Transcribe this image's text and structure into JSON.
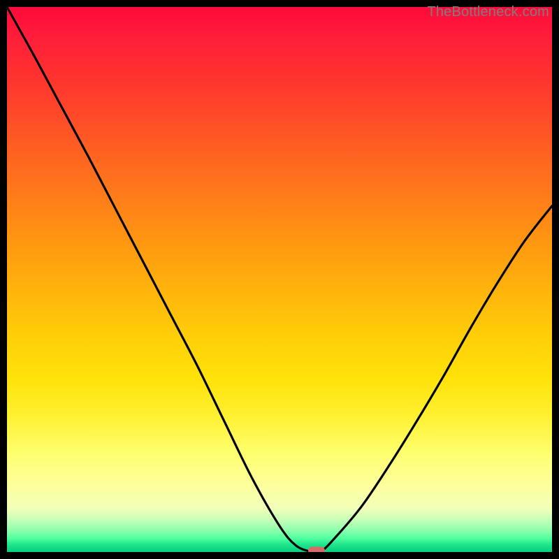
{
  "watermark": "TheBottleneck.com",
  "colors": {
    "background": "#000000",
    "curve_stroke": "#000000",
    "marker_fill": "#d86a68",
    "watermark_text": "#7e7e7e"
  },
  "chart_data": {
    "type": "line",
    "title": "",
    "xlabel": "",
    "ylabel": "",
    "xlim": [
      0,
      1
    ],
    "ylim": [
      0,
      1
    ],
    "x": [
      0.0,
      0.05,
      0.1,
      0.15,
      0.2,
      0.25,
      0.3,
      0.35,
      0.4,
      0.45,
      0.5,
      0.53,
      0.56,
      0.575,
      0.6,
      0.65,
      0.7,
      0.75,
      0.8,
      0.85,
      0.9,
      0.95,
      1.0
    ],
    "values": [
      1.0,
      0.91,
      0.817,
      0.724,
      0.628,
      0.532,
      0.436,
      0.34,
      0.237,
      0.135,
      0.048,
      0.012,
      0.0,
      0.0,
      0.024,
      0.083,
      0.157,
      0.237,
      0.321,
      0.41,
      0.494,
      0.571,
      0.635
    ],
    "marker": {
      "x": 0.568,
      "y": 0.003
    },
    "gradient_stops": [
      {
        "pos": 0.0,
        "color": "#ff0a3a"
      },
      {
        "pos": 0.2,
        "color": "#ff4a28"
      },
      {
        "pos": 0.44,
        "color": "#ff9a10"
      },
      {
        "pos": 0.68,
        "color": "#ffe208"
      },
      {
        "pos": 0.88,
        "color": "#fcff9e"
      },
      {
        "pos": 0.96,
        "color": "#8effad"
      },
      {
        "pos": 1.0,
        "color": "#0ad080"
      }
    ]
  }
}
